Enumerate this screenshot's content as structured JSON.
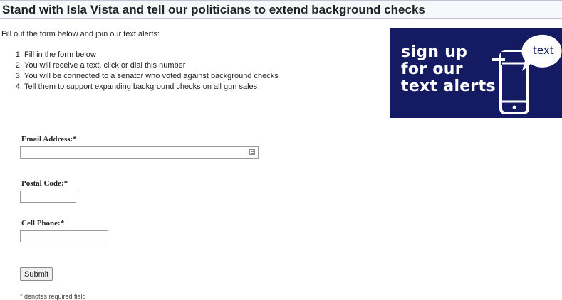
{
  "page": {
    "title": "Stand with Isla Vista and tell our politicians to extend background checks",
    "intro": "Fill out the form below and join our text alerts:",
    "steps": [
      "Fill in the form below",
      "You will receive a text, click or dial this number",
      "You will be connected to a senator who voted against background checks",
      "Tell them to support expanding background checks on all gun sales"
    ]
  },
  "banner": {
    "lines": [
      "sign up",
      "for our",
      "text alerts"
    ],
    "bubble_text": "text",
    "background_color": "#151b63",
    "icon": "phone-icon"
  },
  "form": {
    "email_label": "Email Address:*",
    "email_value": "",
    "postal_label": "Postal Code:*",
    "postal_value": "",
    "phone_label": "Cell Phone:*",
    "phone_value": "",
    "submit_label": "Submit",
    "footnote": "* denotes required field"
  }
}
